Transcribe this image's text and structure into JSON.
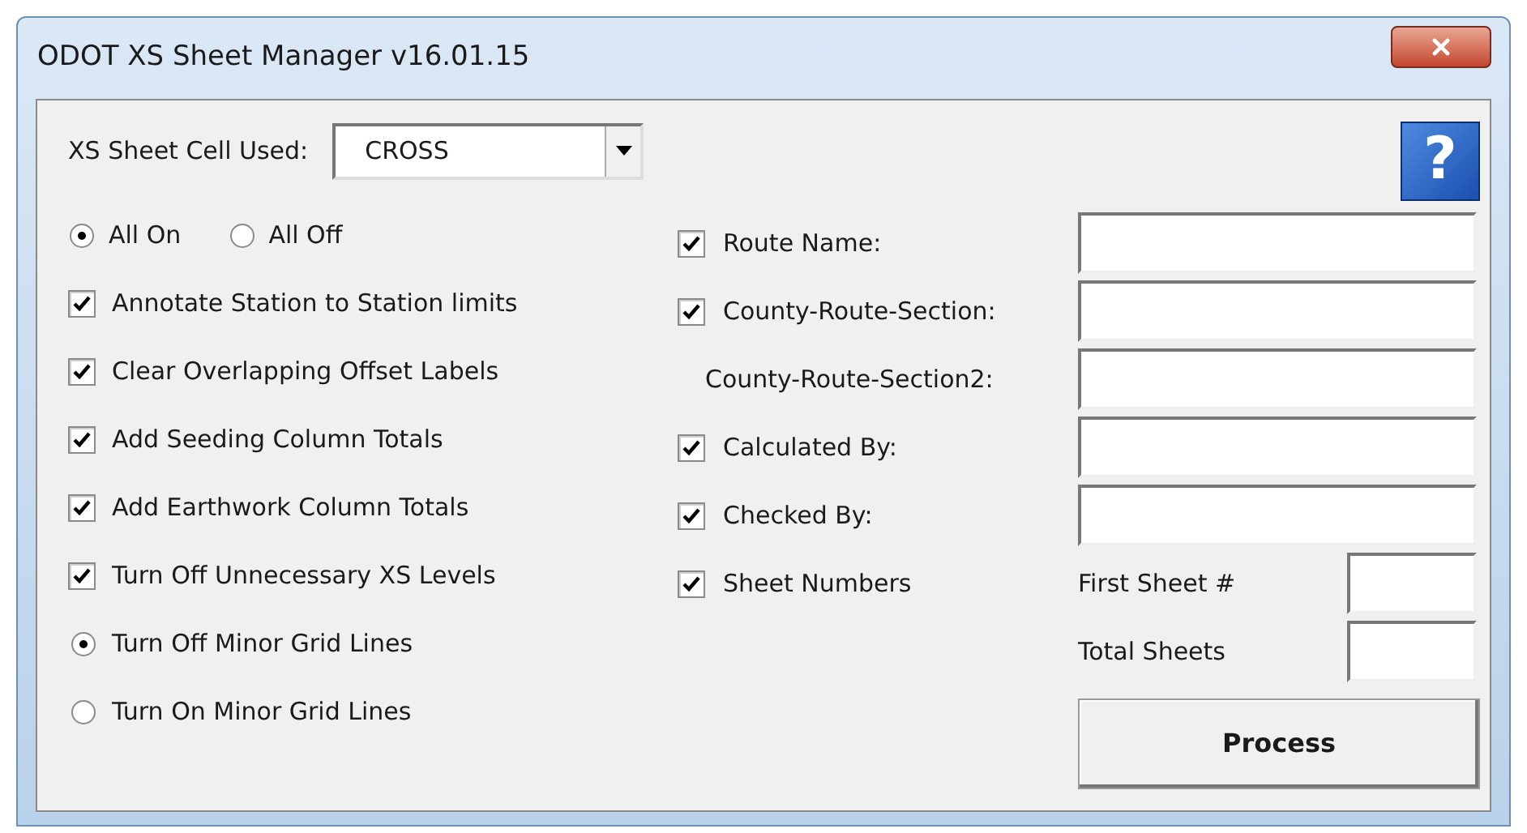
{
  "window": {
    "title": "ODOT XS Sheet Manager v16.01.15"
  },
  "cell_used": {
    "label": "XS Sheet Cell Used:",
    "value": "CROSS"
  },
  "help_button": {
    "label": "?"
  },
  "mode_radios": [
    {
      "label": "All On",
      "selected": true
    },
    {
      "label": "All Off",
      "selected": false
    }
  ],
  "left_options": [
    {
      "kind": "checkbox",
      "label": "Annotate Station to Station limits",
      "checked": true
    },
    {
      "kind": "checkbox",
      "label": "Clear Overlapping Offset Labels",
      "checked": true
    },
    {
      "kind": "checkbox",
      "label": "Add Seeding Column Totals",
      "checked": true
    },
    {
      "kind": "checkbox",
      "label": "Add Earthwork Column Totals",
      "checked": true
    },
    {
      "kind": "checkbox",
      "label": "Turn Off Unnecessary XS Levels",
      "checked": true
    },
    {
      "kind": "radio",
      "label": "Turn Off Minor Grid Lines",
      "selected": true
    },
    {
      "kind": "radio",
      "label": "Turn On Minor Grid Lines",
      "selected": false
    }
  ],
  "right_fields": [
    {
      "kind": "checkbox",
      "label": "Route Name:",
      "checked": true
    },
    {
      "kind": "checkbox",
      "label": "County-Route-Section:",
      "checked": true
    },
    {
      "kind": "plain",
      "label": "County-Route-Section2:"
    },
    {
      "kind": "checkbox",
      "label": "Calculated By:",
      "checked": true
    },
    {
      "kind": "checkbox",
      "label": "Checked By:",
      "checked": true
    }
  ],
  "sheet_numbers": {
    "label": "Sheet Numbers",
    "checked": true
  },
  "sheet_fields": [
    {
      "label": "First Sheet #"
    },
    {
      "label": "Total Sheets"
    }
  ],
  "process_button": {
    "label": "Process"
  }
}
